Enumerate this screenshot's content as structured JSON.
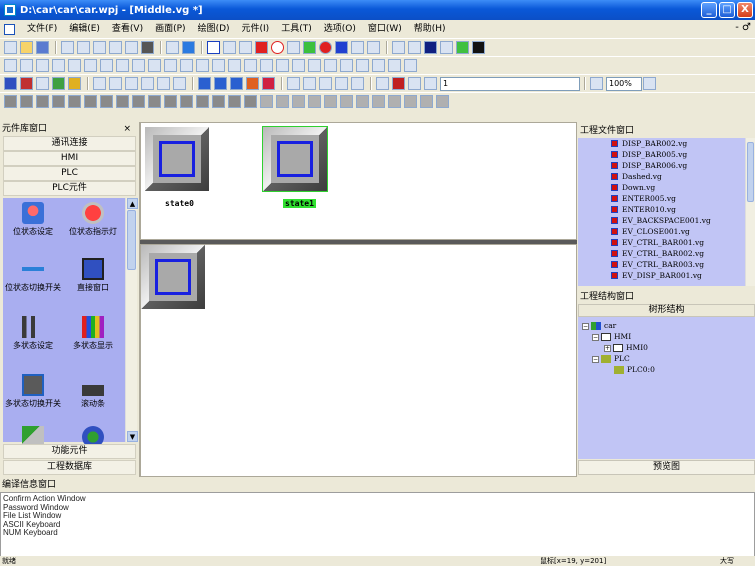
{
  "window": {
    "title": "D:\\car\\car\\car.wpj - [Middle.vg *]",
    "min_label": "_",
    "max_label": "□",
    "close_label": "X"
  },
  "menu": {
    "items": [
      "文件(F)",
      "编辑(E)",
      "查看(V)",
      "画面(P)",
      "绘图(D)",
      "元件(I)",
      "工具(T)",
      "选项(O)",
      "窗口(W)",
      "帮助(H)"
    ],
    "mdi_controls": "- ♂"
  },
  "toolbar": {
    "font_size_value": "1",
    "zoom_value": "100%"
  },
  "left_panel": {
    "title": "元件库窗口",
    "close_label": "×",
    "categories": [
      "通讯连接",
      "HMI",
      "PLC",
      "PLC元件"
    ],
    "components": [
      "位状态设定",
      "位状态指示灯",
      "位状态切换开关",
      "直接窗口",
      "多状态设定",
      "多状态显示",
      "多状态切换开关",
      "滚动条"
    ],
    "footer_tabs": [
      "功能元件",
      "工程数据库"
    ]
  },
  "canvas": {
    "state0_label": "state0",
    "state1_label": "state1"
  },
  "file_panel": {
    "title": "工程文件窗口",
    "files": [
      "DISP_BAR002.vg",
      "DISP_BAR005.vg",
      "DISP_BAR006.vg",
      "Dashed.vg",
      "Down.vg",
      "ENTER005.vg",
      "ENTER010.vg",
      "EV_BACKSPACE001.vg",
      "EV_CLOSE001.vg",
      "EV_CTRL_BAR001.vg",
      "EV_CTRL_BAR002.vg",
      "EV_CTRL_BAR003.vg",
      "EV_DISP_BAR001.vg"
    ]
  },
  "tree_panel": {
    "title": "工程结构窗口",
    "header": "树形结构",
    "nodes": [
      "car",
      "HMI",
      "HMI0",
      "PLC",
      "PLC0:0"
    ],
    "preview_tab": "预览图"
  },
  "log_panel": {
    "title": "编译信息窗口",
    "lines": [
      "Confirm Action Window",
      "Password Window",
      "File List Window",
      "ASCII Keyboard",
      "NUM Keyboard"
    ]
  },
  "status": {
    "left": "就绪",
    "coords": "鼠标[x=19, y=201]",
    "mode": "大写"
  }
}
